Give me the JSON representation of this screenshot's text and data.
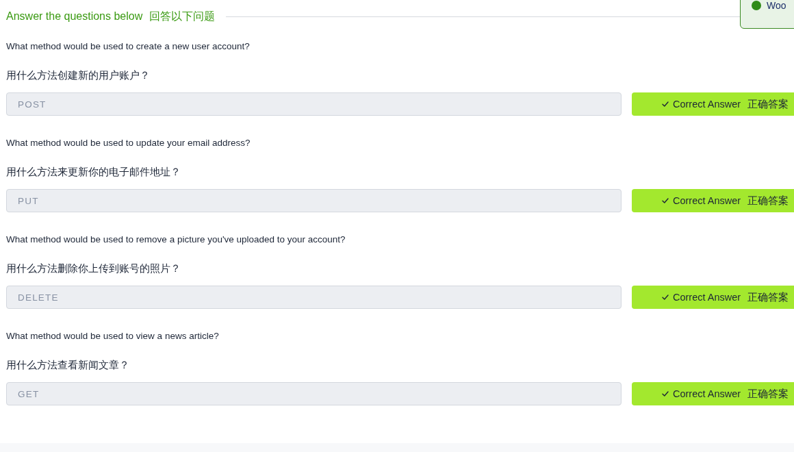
{
  "header": {
    "title": "Answer the questions below",
    "title_zh": "回答以下问题"
  },
  "toast": {
    "message": "Woo"
  },
  "questions": [
    {
      "question": "What method would be used to create a new user account?",
      "question_zh": "用什么方法创建新的用户账户？",
      "answer": "POST",
      "correct": true,
      "button_label": "Correct Answer",
      "button_label_zh": "正确答案"
    },
    {
      "question": "What method would be used to update your email address?",
      "question_zh": "用什么方法来更新你的电子邮件地址？",
      "answer": "PUT",
      "correct": true,
      "button_label": "Correct Answer",
      "button_label_zh": "正确答案"
    },
    {
      "question": "What method would be used to remove a picture you've uploaded to your account?",
      "question_zh": "用什么方法删除你上传到账号的照片？",
      "answer": "DELETE",
      "correct": true,
      "button_label": "Correct Answer",
      "button_label_zh": "正确答案"
    },
    {
      "question": "What method would be used to view a news article?",
      "question_zh": "用什么方法查看新闻文章？",
      "answer": "GET",
      "correct": true,
      "button_label": "Correct Answer",
      "button_label_zh": "正确答案"
    }
  ]
}
